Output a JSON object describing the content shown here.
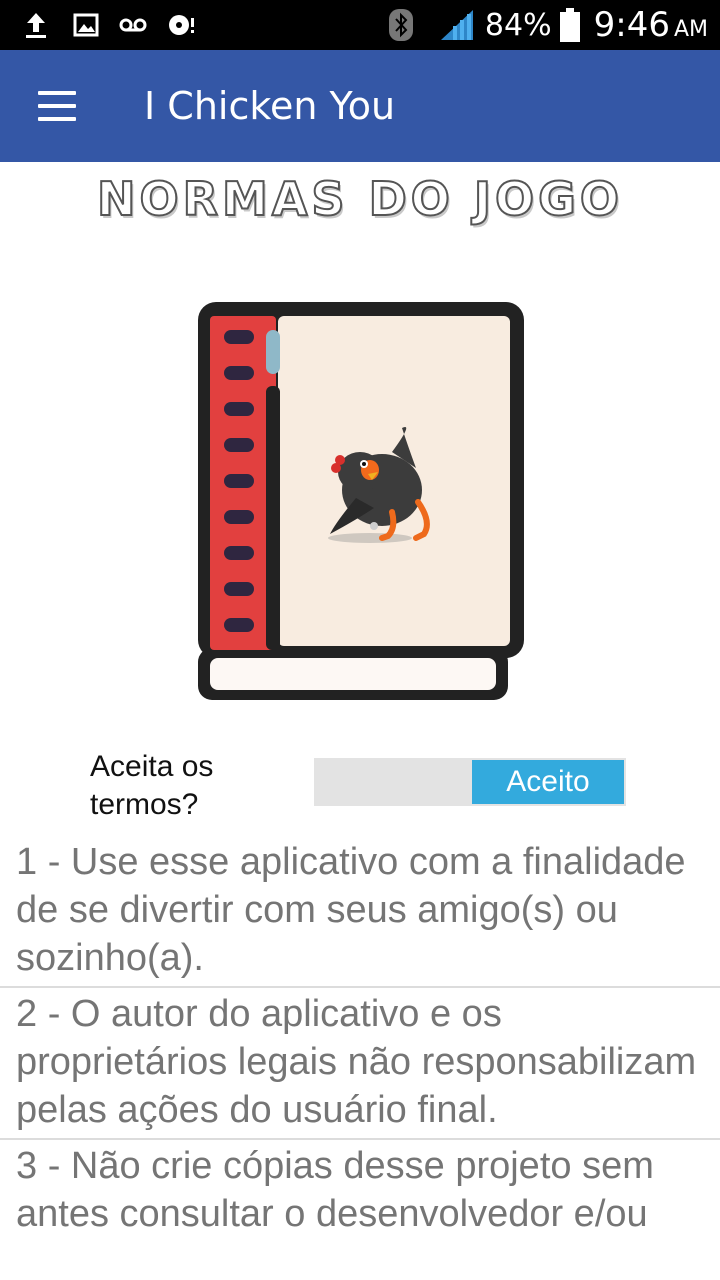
{
  "status_bar": {
    "icons": [
      "upload-icon",
      "image-icon",
      "voicemail-icon",
      "media-icon",
      "bluetooth-icon",
      "signal-icon",
      "battery-icon"
    ],
    "battery_percent": "84%",
    "time": "9:46",
    "ampm": "AM"
  },
  "app_bar": {
    "title": "I Chicken You",
    "color": "#3457a6"
  },
  "heading": "NORMAS DO JOGO",
  "terms": {
    "question": "Aceita os termos?",
    "toggle_label": "Aceito",
    "accent": "#33aadd"
  },
  "rules": [
    "1 - Use esse aplicativo com a finalidade de se divertir com seus amigo(s) ou sozinho(a).",
    "2 - O autor do aplicativo e os proprietários legais não responsabilizam pelas ações do usuário final.",
    "3 - Não crie cópias desse projeto sem antes consultar o desenvolvedor e/ou"
  ]
}
